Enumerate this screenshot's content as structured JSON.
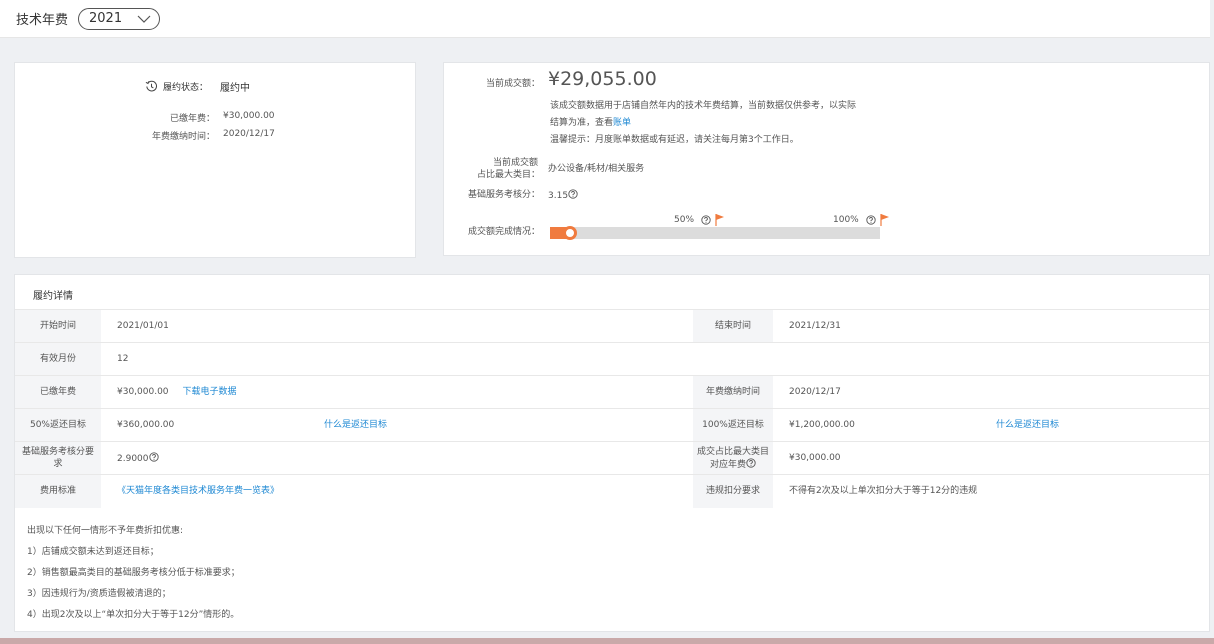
{
  "header": {
    "title": "技术年费",
    "year_select": "2021"
  },
  "status_card": {
    "status_label": "履约状态：",
    "status_value": "履约中",
    "paid_fee_label": "已缴年费：",
    "paid_fee_value": "¥30,000.00",
    "pay_time_label": "年费缴纳时间：",
    "pay_time_value": "2020/12/17"
  },
  "deal_card": {
    "amount_label": "当前成交额：",
    "amount_value": "¥29,055.00",
    "note_line1": "该成交额数据用于店铺自然年内的技术年费结算，当前数据仅供参考，以实际",
    "note_line2": "结算为准，查看",
    "bill_link": "账单",
    "tip": "温馨提示：月度账单数据或有延迟，请关注每月第3个工作日。",
    "max_category_label_line1": "当前成交额",
    "max_category_label_line2": "占比最大类目：",
    "max_category_value": "办公设备/耗材/相关服务",
    "score_label": "基础服务考核分：",
    "score_value": "3.15",
    "progress_label": "成交额完成情况：",
    "progress_fraction": 0.04,
    "milestone_50": "50%",
    "milestone_100": "100%",
    "colors": {
      "accent": "#f07b3f",
      "link": "#1e88d3"
    }
  },
  "detail": {
    "title": "履约详情",
    "start_label": "开始时间",
    "start_value": "2021/01/01",
    "end_label": "结束时间",
    "end_value": "2021/12/31",
    "months_label": "有效月份",
    "months_value": "12",
    "paid_label": "已缴年费",
    "paid_value": "¥30,000.00",
    "download_link": "下载电子数据",
    "pay_time_label": "年费缴纳时间",
    "pay_time_value": "2020/12/17",
    "target50_label": "50%返还目标",
    "target50_value": "¥360,000.00",
    "target50_link": "什么是返还目标",
    "target100_label": "100%返还目标",
    "target100_value": "¥1,200,000.00",
    "target100_link": "什么是返还目标",
    "score_req_label": "基础服务考核分要求",
    "score_req_value": "2.9000",
    "max_cat_fee_label": "成交占比最大类目对应年费",
    "max_cat_fee_value": "¥30,000.00",
    "fee_std_label": "费用标准",
    "fee_std_link": "《天猫年度各类目技术服务年费一览表》",
    "violation_label": "违规扣分要求",
    "violation_value": "不得有2次及以上单次扣分大于等于12分的违规"
  },
  "rules": [
    "出现以下任何一情形不予年费折扣优惠:",
    "1）店铺成交额未达到返还目标；",
    "2）销售额最高类目的基础服务考核分低于标准要求；",
    "3）因违规行为/资质造假被清退的；",
    "4）出现2次及以上“单次扣分大于等于12分”情形的。"
  ]
}
